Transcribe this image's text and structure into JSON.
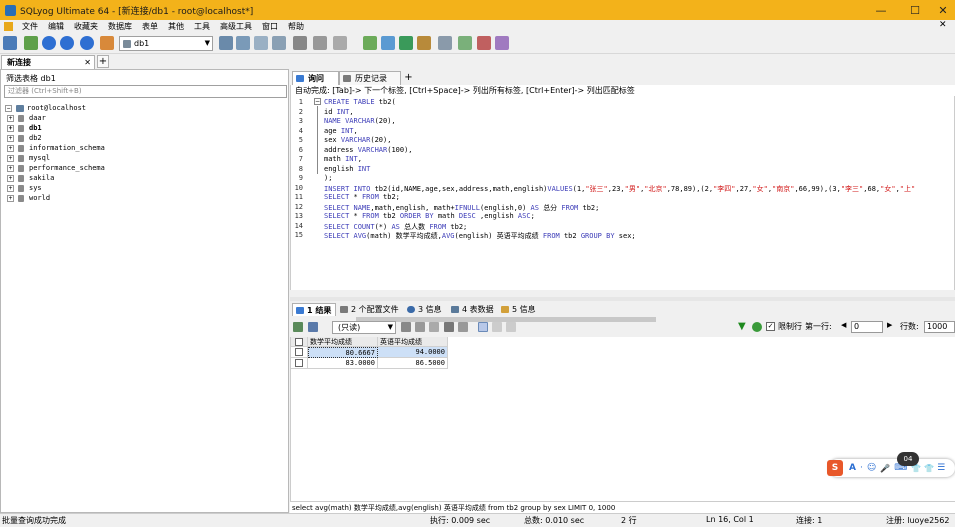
{
  "window": {
    "title": "SQLyog Ultimate 64 - [新连接/db1 - root@localhost*]",
    "controls": [
      "—",
      "☐",
      "✕"
    ]
  },
  "menu": [
    "文件",
    "编辑",
    "收藏夹",
    "数据库",
    "表单",
    "其他",
    "工具",
    "高级工具",
    "窗口",
    "帮助"
  ],
  "toolbar": {
    "db_selected": "db1"
  },
  "connection_tabs": {
    "active": "新连接",
    "close": "✕",
    "add": "+"
  },
  "object_browser": {
    "filter_label": "筛选表格 db1",
    "filter_placeholder": "过滤器 (Ctrl+Shift+B)",
    "root": "root@localhost",
    "databases": [
      "daar",
      "db1",
      "db2",
      "information_schema",
      "mysql",
      "performance_schema",
      "sakila",
      "sys",
      "world"
    ]
  },
  "query_tabs": [
    "询问",
    "历史记录"
  ],
  "query_tab_add": "+",
  "hint": "自动完成: [Tab]-> 下一个标签, [Ctrl+Space]-> 列出所有标签, [Ctrl+Enter]-> 列出匹配标签",
  "editor": {
    "lines": [
      {
        "n": "1",
        "segs": [
          [
            "kw",
            "CREATE TABLE "
          ],
          [
            "",
            "tb2("
          ]
        ]
      },
      {
        "n": "2",
        "segs": [
          [
            "",
            "id "
          ],
          [
            "kw",
            "INT"
          ],
          [
            "",
            ","
          ]
        ]
      },
      {
        "n": "3",
        "segs": [
          [
            "kw",
            "NAME VARCHAR"
          ],
          [
            "",
            "(20),"
          ]
        ]
      },
      {
        "n": "4",
        "segs": [
          [
            "",
            "age "
          ],
          [
            "kw",
            "INT"
          ],
          [
            "",
            ","
          ]
        ]
      },
      {
        "n": "5",
        "segs": [
          [
            "",
            "sex "
          ],
          [
            "kw",
            "VARCHAR"
          ],
          [
            "",
            "(20),"
          ]
        ]
      },
      {
        "n": "6",
        "segs": [
          [
            "",
            "address "
          ],
          [
            "kw",
            "VARCHAR"
          ],
          [
            "",
            "(100),"
          ]
        ]
      },
      {
        "n": "7",
        "segs": [
          [
            "",
            "math "
          ],
          [
            "kw",
            "INT"
          ],
          [
            "",
            ","
          ]
        ]
      },
      {
        "n": "8",
        "segs": [
          [
            "",
            "english "
          ],
          [
            "kw",
            "INT"
          ]
        ]
      },
      {
        "n": "9",
        "segs": [
          [
            "",
            ");"
          ]
        ]
      },
      {
        "n": "10",
        "segs": [
          [
            "kw",
            "INSERT INTO "
          ],
          [
            "",
            "tb2(id,NAME,age,sex,address,math,english)"
          ],
          [
            "kw",
            "VALUES"
          ],
          [
            "",
            "(1,"
          ],
          [
            "st",
            "\"张三\""
          ],
          [
            "",
            ",23,"
          ],
          [
            "st",
            "\"男\""
          ],
          [
            "",
            ","
          ],
          [
            "st",
            "\"北京\""
          ],
          [
            "",
            ",78,89),(2,"
          ],
          [
            "st",
            "\"李四\""
          ],
          [
            "",
            ",27,"
          ],
          [
            "st",
            "\"女\""
          ],
          [
            "",
            ","
          ],
          [
            "st",
            "\"南京\""
          ],
          [
            "",
            ",66,99),(3,"
          ],
          [
            "st",
            "\"李三\""
          ],
          [
            "",
            ",68,"
          ],
          [
            "st",
            "\"女\""
          ],
          [
            "",
            ","
          ],
          [
            "st",
            "\"上\""
          ]
        ]
      },
      {
        "n": "11",
        "segs": [
          [
            "kw",
            "SELECT "
          ],
          [
            "",
            "* "
          ],
          [
            "kw",
            "FROM "
          ],
          [
            "",
            "tb2;"
          ]
        ]
      },
      {
        "n": "12",
        "segs": [
          [
            "kw",
            "SELECT NAME"
          ],
          [
            "",
            ",math,english, math+"
          ],
          [
            "kw",
            "IFNULL"
          ],
          [
            "",
            "(english,0) "
          ],
          [
            "kw",
            "AS "
          ],
          [
            "",
            "总分 "
          ],
          [
            "kw",
            "FROM "
          ],
          [
            "",
            "tb2;"
          ]
        ]
      },
      {
        "n": "13",
        "segs": [
          [
            "kw",
            "SELECT "
          ],
          [
            "",
            "* "
          ],
          [
            "kw",
            "FROM "
          ],
          [
            "",
            "tb2 "
          ],
          [
            "kw",
            "ORDER BY "
          ],
          [
            "",
            "math "
          ],
          [
            "kw",
            "DESC "
          ],
          [
            "",
            ",english "
          ],
          [
            "kw",
            "ASC"
          ],
          [
            "",
            ";"
          ]
        ]
      },
      {
        "n": "14",
        "segs": [
          [
            "kw",
            "SELECT COUNT"
          ],
          [
            "",
            "(*) "
          ],
          [
            "kw",
            "AS "
          ],
          [
            "",
            "总人数 "
          ],
          [
            "kw",
            "FROM "
          ],
          [
            "",
            "tb2;"
          ]
        ]
      },
      {
        "n": "15",
        "segs": [
          [
            "kw",
            "SELECT AVG"
          ],
          [
            "",
            "(math) 数学平均成绩,"
          ],
          [
            "kw",
            "AVG"
          ],
          [
            "",
            "(english) 英语平均成绩 "
          ],
          [
            "kw",
            "FROM "
          ],
          [
            "",
            "tb2 "
          ],
          [
            "kw",
            "GROUP BY "
          ],
          [
            "",
            "sex;"
          ]
        ]
      }
    ]
  },
  "result_tabs": [
    "1 结果",
    "2 个配置文件",
    "3 信息",
    "4 表数据",
    "5 信息"
  ],
  "result_toolbar": {
    "mode": "(只读)",
    "limit_label": "限制行",
    "first_row_label": "第一行:",
    "first_row_value": "0",
    "rows_label": "行数:",
    "rows_value": "1000"
  },
  "result_grid": {
    "columns": [
      "数学平均成绩",
      "英语平均成绩"
    ],
    "rows": [
      [
        "80.6667",
        "94.0000"
      ],
      [
        "83.0000",
        "86.5000"
      ]
    ]
  },
  "sql_status": "select avg(math) 数学平均成绩,avg(english) 英语平均成绩 from tb2 group by sex LIMIT 0, 1000",
  "widget": {
    "badge": "04",
    "items": [
      "S",
      "A",
      "·",
      "☺",
      "🎤",
      "⌨",
      "👕",
      "👕",
      "☰"
    ]
  },
  "statusbar": {
    "message": "批量查询成功完成",
    "exec_time": "执行: 0.009 sec",
    "total_time": "总数: 0.010 sec",
    "rows": "2 行",
    "position": "Ln 16, Col 1",
    "connections": "连接: 1",
    "registered": "注册: luoye2562"
  }
}
